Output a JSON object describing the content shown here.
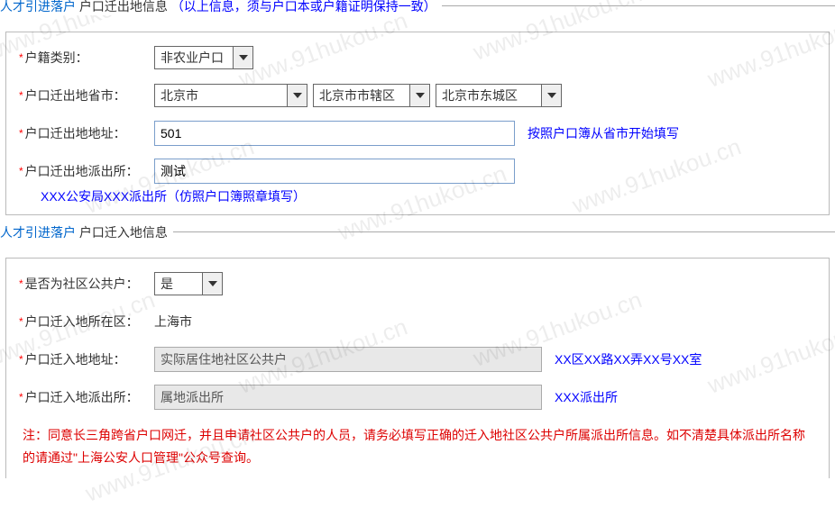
{
  "watermark_text": "www.91hukou.cn",
  "section1": {
    "title_main": "人才引进落户",
    "title_sub": "户口迁出地信息",
    "title_note": "（以上信息，须与户口本或户籍证明保持一致）",
    "fields": {
      "type_label": "户籍类别：",
      "type_value": "非农业户口",
      "province_label": "户口迁出地省市：",
      "province_value": "北京市",
      "city_value": "北京市市辖区",
      "district_value": "北京市东城区",
      "address_label": "户口迁出地地址：",
      "address_value": "501",
      "address_hint": "按照户口簿从省市开始填写",
      "station_label": "户口迁出地派出所：",
      "station_value": "测试",
      "station_hint": "XXX公安局XXX派出所（仿照户口簿照章填写）"
    }
  },
  "section2": {
    "title_main": "人才引进落户",
    "title_sub": "户口迁入地信息",
    "fields": {
      "community_label": "是否为社区公共户：",
      "community_value": "是",
      "district_label": "户口迁入地所在区：",
      "district_value": "上海市",
      "address_label": "户口迁入地地址：",
      "address_value": "实际居住地社区公共户",
      "address_hint": "XX区XX路XX弄XX号XX室",
      "station_label": "户口迁入地派出所：",
      "station_value": "属地派出所",
      "station_hint": "XXX派出所",
      "note": "注：同意长三角跨省户口网迁，并且申请社区公共户的人员，请务必填写正确的迁入地社区公共户所属派出所信息。如不清楚具体派出所名称的请通过\"上海公安人口管理\"公众号查询。"
    }
  }
}
